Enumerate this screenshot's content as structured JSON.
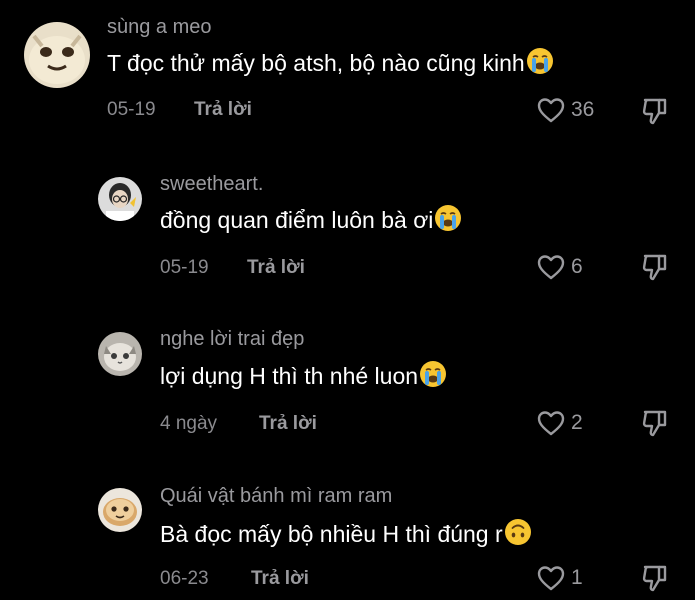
{
  "comments": [
    {
      "username": "sùng a meo",
      "text": "T đọc thử mấy bộ atsh, bộ nào cũng kinh",
      "emoji": "loudly-crying-face",
      "date": "05-19",
      "reply_label": "Trả lời",
      "likes": "36"
    },
    {
      "username": "sweetheart.",
      "text": "đồng quan điểm luôn bà ơi",
      "emoji": "loudly-crying-face",
      "date": "05-19",
      "reply_label": "Trả lời",
      "likes": "6"
    },
    {
      "username": "nghe lời trai đẹp",
      "text": "lợi dụng H thì th nhé luon",
      "emoji": "loudly-crying-face",
      "date": "4 ngày",
      "reply_label": "Trả lời",
      "likes": "2"
    },
    {
      "username": "Quái vật bánh mì ram ram",
      "text": "Bà đọc mấy bộ nhiều H thì đúng r",
      "emoji": "upside-down-face",
      "date": "06-23",
      "reply_label": "Trả lời",
      "likes": "1"
    }
  ],
  "colors": {
    "background": "#000000",
    "username": "#9a9a9e",
    "text": "#ffffff",
    "meta": "#8a8a8e",
    "emoji_yellow": "#f7c531",
    "tear_blue": "#4aa3e8"
  },
  "icons": {
    "like": "heart-outline-icon",
    "dislike": "thumbs-down-icon"
  }
}
